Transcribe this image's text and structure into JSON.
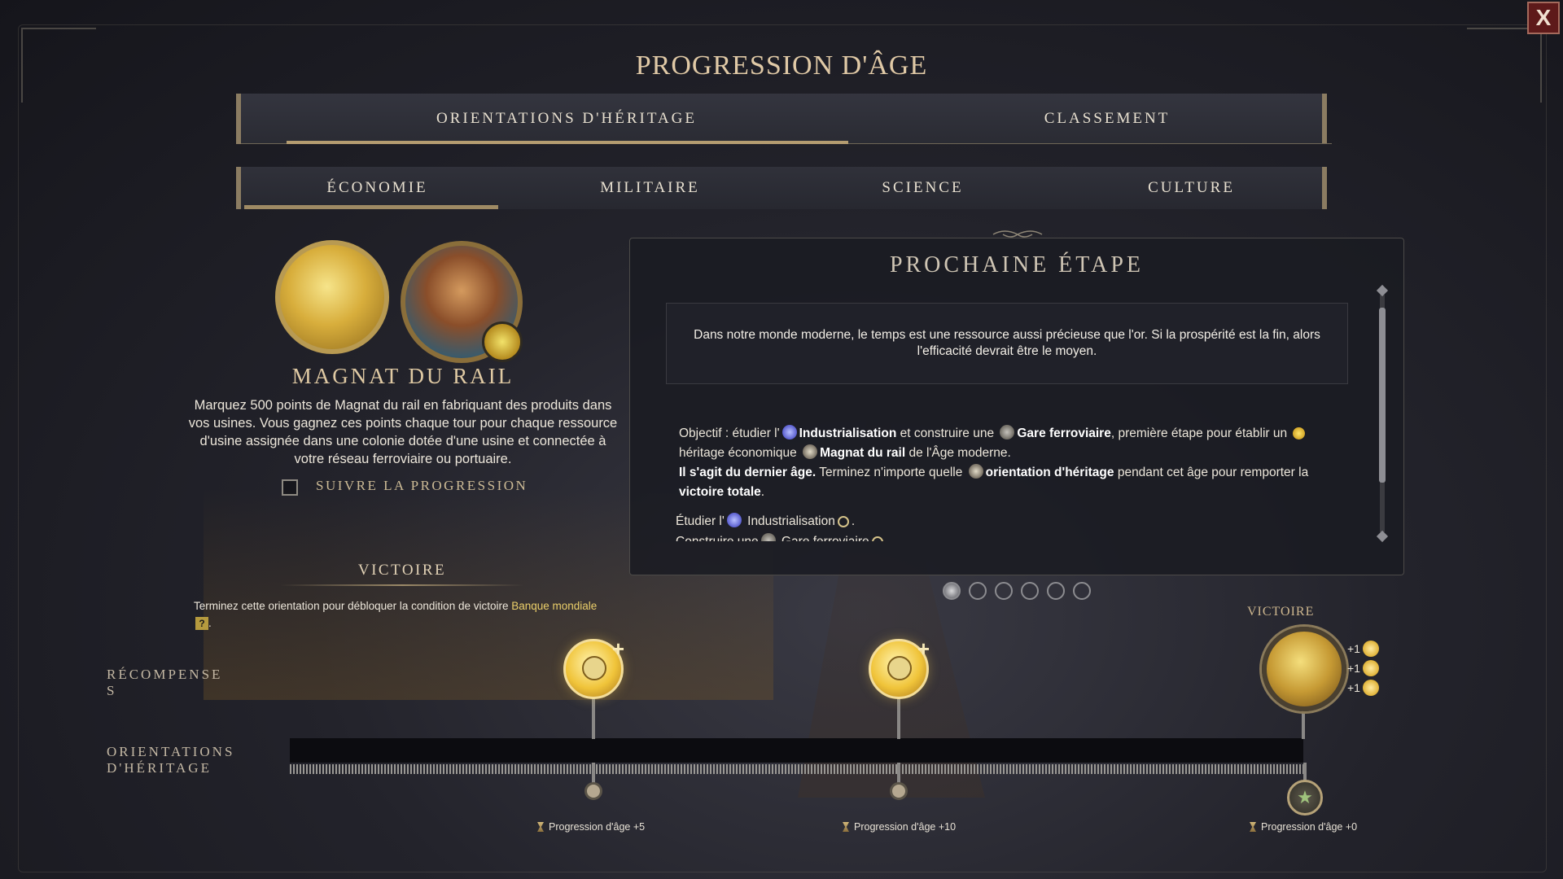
{
  "window": {
    "title": "PROGRESSION D'ÂGE",
    "close_label": "X"
  },
  "top_tabs": [
    {
      "label": "ORIENTATIONS D'HÉRITAGE",
      "active": true
    },
    {
      "label": "CLASSEMENT",
      "active": false
    }
  ],
  "sub_tabs": [
    {
      "label": "ÉCONOMIE",
      "active": true
    },
    {
      "label": "MILITAIRE",
      "active": false
    },
    {
      "label": "SCIENCE",
      "active": false
    },
    {
      "label": "CULTURE",
      "active": false
    }
  ],
  "legacy": {
    "name": "MAGNAT DU RAIL",
    "description": "Marquez 500 points de Magnat du rail en fabriquant des produits dans vos usines. Vous gagnez ces points chaque tour pour chaque ressource d'usine assignée dans une colonie dotée d'une usine et connectée à votre réseau ferroviaire ou portuaire.",
    "track_label": "SUIVRE LA PROGRESSION",
    "track_checked": false
  },
  "victory": {
    "heading": "VICTOIRE",
    "text_before": "Terminez cette orientation pour débloquer la condition de victoire ",
    "link": "Banque mondiale",
    "qmark": "?",
    "text_after": "."
  },
  "next_step": {
    "title": "PROCHAINE ÉTAPE",
    "quote": "Dans notre monde moderne, le temps est une ressource aussi précieuse que l'or. Si la prospérité est la fin, alors l'efficacité devrait être le moyen.",
    "objective": {
      "t1": "Objectif : étudier l'",
      "industrialisation": "Industrialisation",
      "t2": " et construire une ",
      "gare": "Gare ferroviaire",
      "t3": ", première étape pour établir un ",
      "t4": " héritage économique ",
      "magnat": "Magnat du rail",
      "t5": " de l'Âge moderne.",
      "last_age": "Il s'agit du dernier âge.",
      "t6": " Terminez n'importe quelle ",
      "orientation": "orientation d'héritage",
      "t7": " pendant cet âge pour remporter la ",
      "total": "victoire totale",
      "t8": "."
    },
    "step1": {
      "t1": "Étudier l'",
      "t2": " Industrialisation",
      "t3": "."
    },
    "step2": {
      "t1": "Construire une",
      "t2": " Gare ferroviaire"
    },
    "pages": 6,
    "active_page": 1
  },
  "track": {
    "rewards_label": "RÉCOMPENSES",
    "rewards_label_l1": "RÉCOMPENSE",
    "rewards_label_l2": "S",
    "legacy_label_l1": "ORIENTATIONS",
    "legacy_label_l2": "D'HÉRITAGE",
    "victory_label": "VICTOIRE",
    "bonuses": [
      "+1",
      "+1",
      "+1"
    ],
    "milestones": [
      {
        "label": "Progression d'âge +5"
      },
      {
        "label": "Progression d'âge +10"
      },
      {
        "label": "Progression d'âge +0"
      }
    ]
  },
  "colors": {
    "accent": "#d9c196",
    "gold": "#ebcf6a",
    "panel": "#1b1c22"
  }
}
